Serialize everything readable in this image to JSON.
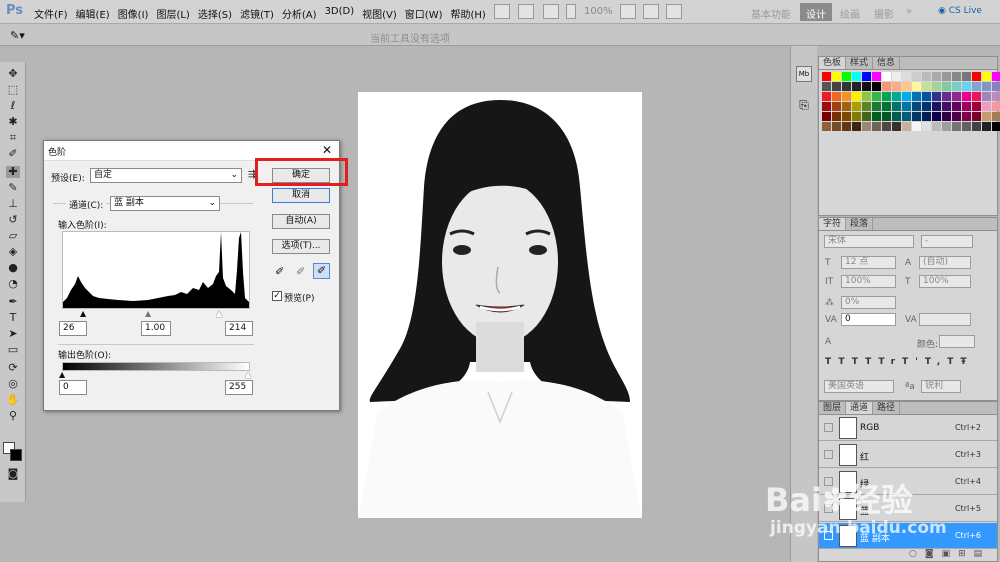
{
  "app": {
    "logo": "Ps"
  },
  "menu": [
    "文件(F)",
    "编辑(E)",
    "图像(I)",
    "图层(L)",
    "选择(S)",
    "滤镜(T)",
    "分析(A)",
    "3D(D)",
    "视图(V)",
    "窗口(W)",
    "帮助(H)"
  ],
  "zoom": "100%",
  "workspaces": {
    "basic": "基本功能",
    "design": "设计",
    "paint": "绘画",
    "photo": "摄影",
    "more": "»",
    "cslive": "CS Live"
  },
  "options_hint": "当前工具没有选项",
  "swatch_tabs": [
    "色板",
    "样式",
    "信息"
  ],
  "swatch_colors": [
    "#ff0000",
    "#ffff00",
    "#00ff00",
    "#00ffff",
    "#0000ff",
    "#ff00ff",
    "#ffffff",
    "#eeeeee",
    "#dddddd",
    "#cccccc",
    "#bbbbbb",
    "#aaaaaa",
    "#999999",
    "#888888",
    "#777777",
    "#ff0000",
    "#ffff00",
    "#ff00ff",
    "#555555",
    "#444444",
    "#333333",
    "#222222",
    "#111111",
    "#000000",
    "#f7977a",
    "#f9ad81",
    "#fdc68a",
    "#fff79a",
    "#c4df9b",
    "#a2d39c",
    "#82ca9d",
    "#7bcdc8",
    "#6ecff6",
    "#7ea7d8",
    "#8493ca",
    "#8882be",
    "#ed1c24",
    "#f26522",
    "#f7941d",
    "#fff200",
    "#8dc73f",
    "#39b54a",
    "#00a651",
    "#00a99d",
    "#00aeef",
    "#0072bc",
    "#0054a6",
    "#2e3192",
    "#662d91",
    "#92278f",
    "#ec008c",
    "#ed145b",
    "#a186be",
    "#bd8cbf",
    "#9e0b0f",
    "#a0410d",
    "#a3620a",
    "#aba000",
    "#598527",
    "#197b30",
    "#007236",
    "#00746b",
    "#0076a3",
    "#004a80",
    "#003471",
    "#1b1464",
    "#440e62",
    "#630460",
    "#9e005d",
    "#9e0039",
    "#f49ac2",
    "#f6989d",
    "#790000",
    "#7b2e00",
    "#7d4900",
    "#827b00",
    "#406618",
    "#005e20",
    "#005826",
    "#005952",
    "#005b7f",
    "#003663",
    "#002157",
    "#0d004c",
    "#32004b",
    "#4b0049",
    "#7b0046",
    "#7a0026",
    "#c69c6d",
    "#a67c52",
    "#8c6239",
    "#754c24",
    "#603913",
    "#3c2415",
    "#998675",
    "#736357",
    "#534741",
    "#362f2d",
    "#c7b299",
    "#f5f5f5",
    "#e0e0e0",
    "#bdbdbd",
    "#9e9e9e",
    "#757575",
    "#616161",
    "#424242",
    "#212121",
    "#000000"
  ],
  "char_tabs": [
    "字符",
    "段落"
  ],
  "char": {
    "font": "宋体",
    "style": "-",
    "size": "12 点",
    "leading": "(自动)",
    "vscale": "100%",
    "hscale": "100%",
    "baseline": "0%",
    "tracking": "0",
    "color_label": "颜色:",
    "lang": "美国英语",
    "aa_label": "aa",
    "aa": "锐利",
    "styles": [
      "T",
      "T",
      "TT",
      "Tr",
      "T'",
      "T,",
      "T",
      "Ŧ"
    ]
  },
  "channel_tabs": [
    "图层",
    "通道",
    "路径"
  ],
  "channels": [
    {
      "name": "RGB",
      "key": "Ctrl+2"
    },
    {
      "name": "红",
      "key": "Ctrl+3"
    },
    {
      "name": "绿",
      "key": "Ctrl+4"
    },
    {
      "name": "蓝",
      "key": "Ctrl+5"
    },
    {
      "name": "蓝 副本",
      "key": "Ctrl+6"
    }
  ],
  "dialog": {
    "title": "色阶",
    "preset_label": "预设(E):",
    "preset_value": "自定",
    "channel_label": "通道(C):",
    "channel_value": "蓝 副本",
    "input_label": "输入色阶(I):",
    "input_black": "26",
    "input_gamma": "1.00",
    "input_white": "214",
    "output_label": "输出色阶(O):",
    "output_black": "0",
    "output_white": "255",
    "ok": "确定",
    "cancel": "取消",
    "auto": "自动(A)",
    "options": "选项(T)...",
    "preview": "预览(P)",
    "preview_checked": true
  },
  "watermark": {
    "brand": "Bai",
    "brand2": "经验",
    "url": "jingyan.baidu.com"
  }
}
